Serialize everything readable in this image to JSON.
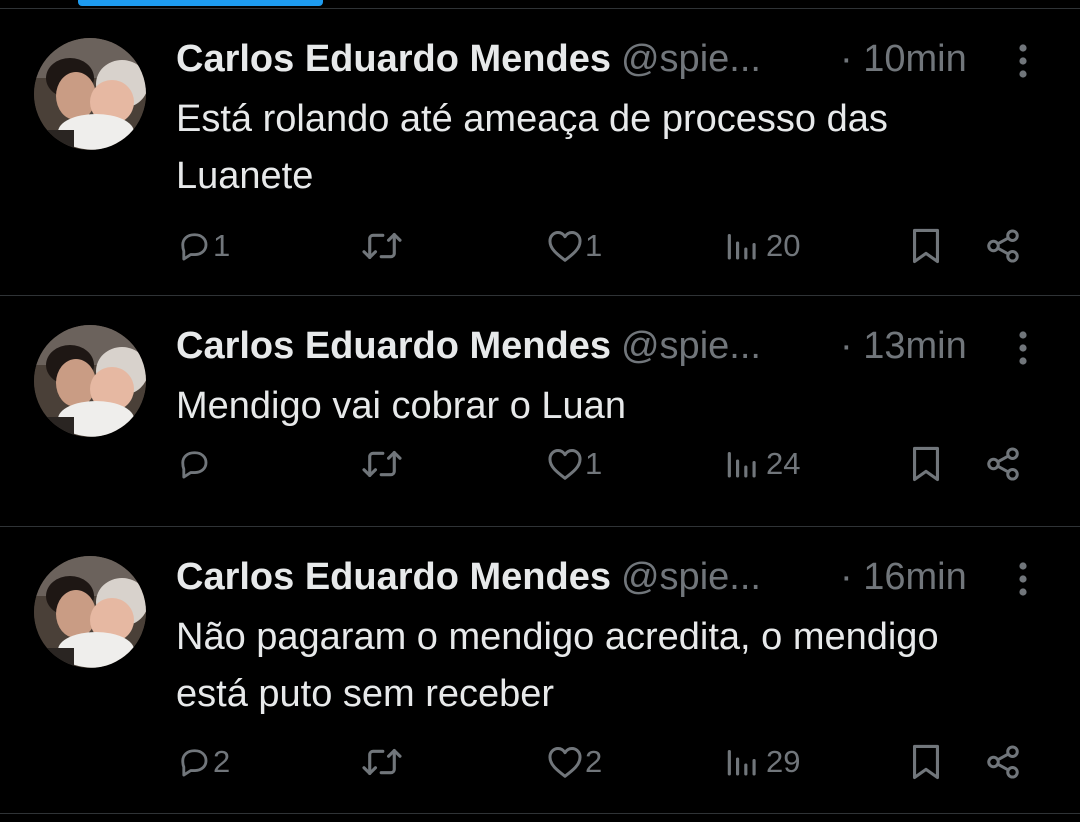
{
  "colors": {
    "background": "#000000",
    "text_primary": "#e7e9ea",
    "text_secondary": "#71767b",
    "divider": "#2f3336",
    "accent": "#1d9bf0"
  },
  "icons": {
    "reply": "reply-icon",
    "retweet": "retweet-icon",
    "like": "heart-icon",
    "views": "views-chart-icon",
    "bookmark": "bookmark-icon",
    "share": "share-icon",
    "more": "more-vertical-icon"
  },
  "tweets": [
    {
      "name": "Carlos Eduardo Mendes",
      "handle": "@spie...",
      "time": "· 10min",
      "text": "Está rolando até ameaça de processo das\nLuanete",
      "replies": "1",
      "retweets": "",
      "likes": "1",
      "views": "20"
    },
    {
      "name": "Carlos Eduardo Mendes",
      "handle": "@spie...",
      "time": "· 13min",
      "text": "Mendigo vai cobrar o Luan",
      "replies": "",
      "retweets": "",
      "likes": "1",
      "views": "24"
    },
    {
      "name": "Carlos Eduardo Mendes",
      "handle": "@spie...",
      "time": "· 16min",
      "text": "Não pagaram o mendigo acredita, o mendigo\nestá puto sem receber",
      "replies": "2",
      "retweets": "",
      "likes": "2",
      "views": "29"
    }
  ]
}
